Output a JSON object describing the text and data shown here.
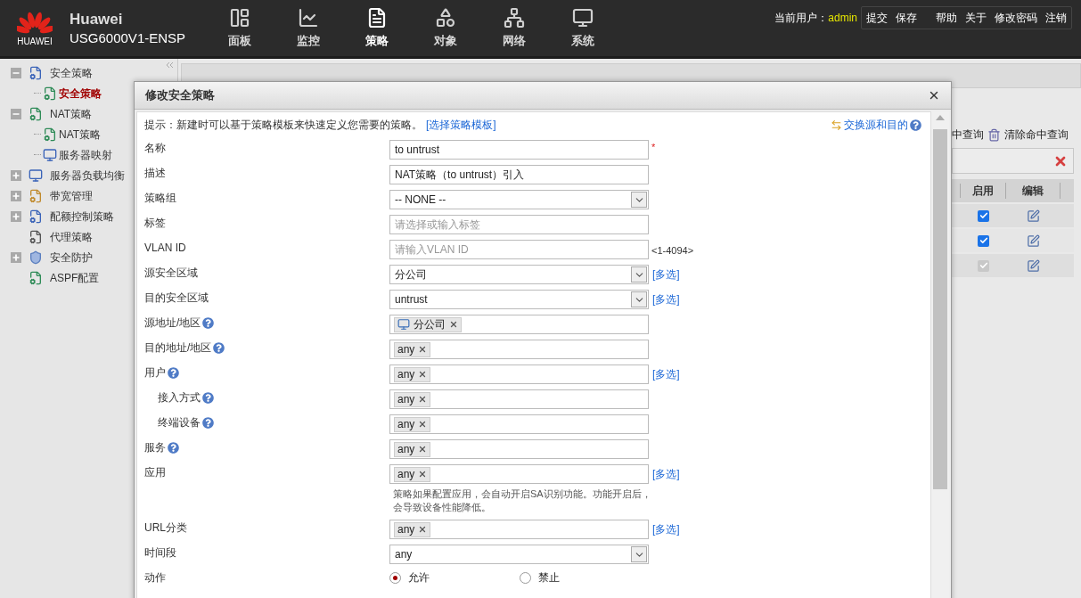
{
  "header": {
    "brand": "HUAWEI",
    "product": "Huawei",
    "model": "USG6000V1-ENSP",
    "nav": [
      {
        "label": "面板",
        "selected": false
      },
      {
        "label": "监控",
        "selected": false
      },
      {
        "label": "策略",
        "selected": true
      },
      {
        "label": "对象",
        "selected": false
      },
      {
        "label": "网络",
        "selected": false
      },
      {
        "label": "系统",
        "selected": false
      }
    ],
    "user_label": "当前用户：",
    "user": "admin",
    "actions": [
      "提交",
      "保存",
      "帮助",
      "关于",
      "修改密码",
      "注销"
    ]
  },
  "sidebar": {
    "items": [
      {
        "label": "安全策略",
        "kind": "branch",
        "expanded": true,
        "selected": false,
        "children": [
          {
            "label": "安全策略",
            "selected": true
          }
        ]
      },
      {
        "label": "NAT策略",
        "kind": "branch",
        "expanded": true,
        "selected": false,
        "children": [
          {
            "label": "NAT策略",
            "selected": false
          },
          {
            "label": "服务器映射",
            "selected": false
          }
        ]
      },
      {
        "label": "服务器负载均衡",
        "kind": "branch",
        "expanded": false,
        "selected": false
      },
      {
        "label": "带宽管理",
        "kind": "branch",
        "expanded": false,
        "selected": false
      },
      {
        "label": "配额控制策略",
        "kind": "branch",
        "expanded": false,
        "selected": false
      },
      {
        "label": "代理策略",
        "kind": "leaf",
        "selected": false
      },
      {
        "label": "安全防护",
        "kind": "branch",
        "expanded": false,
        "selected": false
      },
      {
        "label": "ASPF配置",
        "kind": "leaf",
        "selected": false
      }
    ]
  },
  "list_panel": {
    "toolbar": [
      "中查询",
      "清除命中查询"
    ],
    "columns": [
      "启用",
      "编辑"
    ],
    "rows": [
      {
        "enabled": true,
        "disabled": false
      },
      {
        "enabled": true,
        "disabled": false
      },
      {
        "enabled": true,
        "disabled": true
      }
    ]
  },
  "dialog": {
    "title": "修改安全策略",
    "hint": "提示：新建时可以基于策略模板来快速定义您需要的策略。",
    "template_link": "[选择策略模板]",
    "swap_link": "交换源和目的",
    "rows": [
      {
        "label": "名称",
        "kind": "text",
        "value": "to untrust",
        "mark": "*",
        "help": false
      },
      {
        "label": "描述",
        "kind": "text",
        "value": "NAT策略（to untrust）引入",
        "help": false
      },
      {
        "label": "策略组",
        "kind": "select",
        "value": "-- NONE --",
        "help": false
      },
      {
        "label": "标签",
        "kind": "text",
        "placeholder": "请选择或输入标签",
        "help": false
      },
      {
        "label": "VLAN ID",
        "kind": "text",
        "placeholder": "请输入VLAN ID",
        "suffix": "<1-4094>",
        "help": false
      },
      {
        "label": "源安全区域",
        "kind": "select",
        "value": "分公司",
        "link": "[多选]",
        "help": false
      },
      {
        "label": "目的安全区域",
        "kind": "select",
        "value": "untrust",
        "link": "[多选]",
        "help": false
      },
      {
        "label": "源地址/地区",
        "kind": "tags",
        "tags": [
          {
            "text": "分公司",
            "icon": true
          }
        ],
        "help": true
      },
      {
        "label": "目的地址/地区",
        "kind": "tags",
        "tags": [
          {
            "text": "any",
            "icon": false
          }
        ],
        "help": true
      },
      {
        "label": "用户",
        "kind": "tags",
        "tags": [
          {
            "text": "any",
            "icon": false
          }
        ],
        "link": "[多选]",
        "help": true,
        "children": [
          {
            "label": "接入方式",
            "kind": "tags",
            "tags": [
              {
                "text": "any",
                "icon": false
              }
            ],
            "help": true
          },
          {
            "label": "终端设备",
            "kind": "tags",
            "tags": [
              {
                "text": "any",
                "icon": false
              }
            ],
            "help": true
          }
        ]
      },
      {
        "label": "服务",
        "kind": "tags",
        "tags": [
          {
            "text": "any",
            "icon": false
          }
        ],
        "help": true
      },
      {
        "label": "应用",
        "kind": "tags",
        "tags": [
          {
            "text": "any",
            "icon": false
          }
        ],
        "link": "[多选]",
        "note": "策略如果配置应用，会自动开启SA识别功能。功能开启后，会导致设备性能降低。",
        "help": false
      },
      {
        "label": "URL分类",
        "kind": "tags",
        "tags": [
          {
            "text": "any",
            "icon": false
          }
        ],
        "link": "[多选]",
        "help": false
      },
      {
        "label": "时间段",
        "kind": "select",
        "value": "any",
        "help": false
      },
      {
        "label": "动作",
        "kind": "radio",
        "options": [
          {
            "label": "允许",
            "selected": true
          },
          {
            "label": "禁止",
            "selected": false
          }
        ],
        "help": false
      }
    ]
  }
}
